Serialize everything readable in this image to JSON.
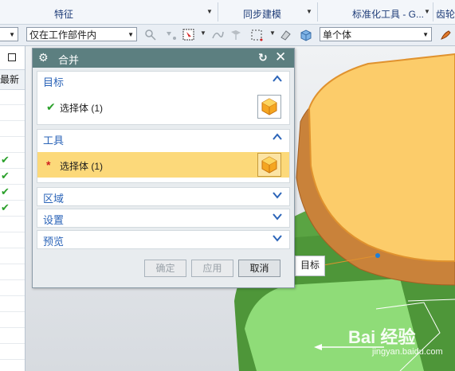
{
  "ribbon": {
    "groups": [
      {
        "label": "特征"
      },
      {
        "label": "同步建模"
      },
      {
        "label": "标准化工具 - G..."
      },
      {
        "label": "齿轮..."
      }
    ]
  },
  "toolbar": {
    "scope_select": "仅在工作部件内",
    "body_filter_select": "单个体"
  },
  "left_panel": {
    "column_header": "最新",
    "checked_rows": 4
  },
  "dialog": {
    "title": "合并",
    "sections": {
      "target": {
        "header": "目标",
        "select_label": "选择体 (1)",
        "state": "expanded"
      },
      "tool": {
        "header": "工具",
        "select_label": "选择体 (1)",
        "state": "expanded"
      },
      "region": {
        "header": "区域",
        "state": "collapsed"
      },
      "settings": {
        "header": "设置",
        "state": "collapsed"
      },
      "preview": {
        "header": "预览",
        "state": "collapsed"
      }
    },
    "buttons": {
      "ok": "确定",
      "apply": "应用",
      "cancel": "取消"
    }
  },
  "viewport": {
    "callout": "目标"
  },
  "watermark": {
    "text": "Bai 经验",
    "url": "jingyan.baidu.com"
  },
  "colors": {
    "title_bar": "#5c7f80",
    "section_header": "#2b64b8",
    "active_row": "#fcd97a",
    "check": "#2aa02a",
    "required": "#d02020",
    "part_top": "#fccc6a",
    "part_side": "#c9823a",
    "green_body": "#5aa443"
  }
}
